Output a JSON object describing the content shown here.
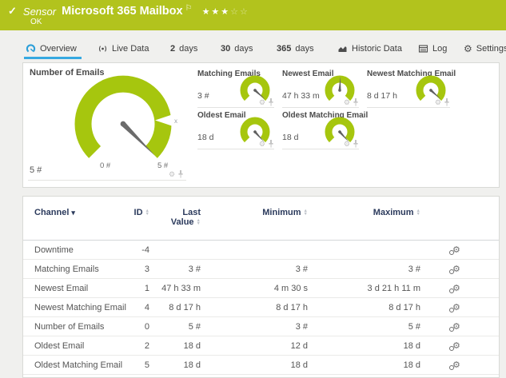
{
  "colors": {
    "status_green": "#b2c31d",
    "gauge_green": "#a6c60e",
    "accent_blue": "#36a9e1",
    "icon_blue": "#2d9fd8",
    "header_navy": "#2b3a5c",
    "page_bg": "#f0f0ee"
  },
  "icons": {
    "check": "✓",
    "flag": "⚐",
    "gear": "⚙",
    "caret_down": "▾",
    "sort_up": "▲",
    "sort_down": "▼"
  },
  "header": {
    "kind": "Sensor",
    "title": "Microsoft 365 Mailbox",
    "status": "OK",
    "stars_filled": "★★★",
    "stars_empty": "☆☆"
  },
  "tabs": [
    {
      "label": "Overview",
      "active": true
    },
    {
      "label": "Live Data"
    },
    {
      "num": "2",
      "label": "days"
    },
    {
      "num": "30",
      "label": "days"
    },
    {
      "num": "365",
      "label": "days"
    },
    {
      "label": "Historic Data"
    },
    {
      "label": "Log"
    },
    {
      "label": "Settings"
    }
  ],
  "gauges": {
    "main": {
      "title": "Number of Emails",
      "value": "5 #",
      "min_label": "0 #",
      "max_label": "5 #",
      "marker_label": "x",
      "needle_deg": 135
    },
    "small": [
      {
        "title": "Matching Emails",
        "value": "3 #",
        "needle_deg": 132
      },
      {
        "title": "Newest Email",
        "value": "47 h 33 m",
        "needle_deg": 3
      },
      {
        "title": "Newest Matching Email",
        "value": "8 d 17 h",
        "needle_deg": 132
      },
      {
        "title": "Oldest Email",
        "value": "18 d",
        "needle_deg": 138
      },
      {
        "title": "Oldest Matching Email",
        "value": "18 d",
        "needle_deg": 138
      }
    ]
  },
  "table": {
    "columns": [
      {
        "label": "Channel"
      },
      {
        "label": "ID"
      },
      {
        "line1": "Last",
        "line2": "Value"
      },
      {
        "label": "Minimum"
      },
      {
        "label": "Maximum"
      }
    ],
    "rows": [
      {
        "channel": "Downtime",
        "id": "-4",
        "last": "",
        "min": "",
        "max": ""
      },
      {
        "channel": "Matching Emails",
        "id": "3",
        "last": "3 #",
        "min": "3 #",
        "max": "3 #"
      },
      {
        "channel": "Newest Email",
        "id": "1",
        "last": "47 h 33 m",
        "min": "4 m 30 s",
        "max": "3 d 21 h 11 m"
      },
      {
        "channel": "Newest Matching Email",
        "id": "4",
        "last": "8 d 17 h",
        "min": "8 d 17 h",
        "max": "8 d 17 h"
      },
      {
        "channel": "Number of Emails",
        "id": "0",
        "last": "5 #",
        "min": "3 #",
        "max": "5 #"
      },
      {
        "channel": "Oldest Email",
        "id": "2",
        "last": "18 d",
        "min": "12 d",
        "max": "18 d"
      },
      {
        "channel": "Oldest Matching Email",
        "id": "5",
        "last": "18 d",
        "min": "18 d",
        "max": "18 d"
      }
    ]
  }
}
